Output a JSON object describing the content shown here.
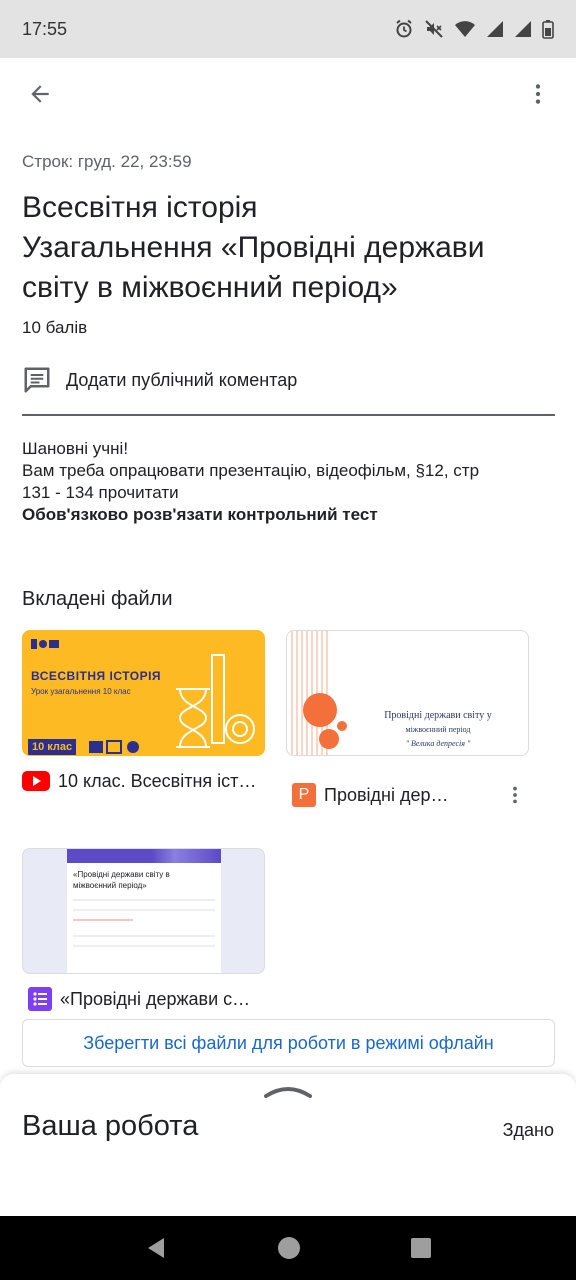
{
  "status_bar": {
    "time": "17:55"
  },
  "assignment": {
    "due": "Строк: груд. 22, 23:59",
    "title_line1": "Всесвітня історія",
    "title_line2": "Узагальнення «Провідні держави",
    "title_line3": "світу в міжвоєнний період»",
    "points": "10 балів",
    "comment_label": "Додати публічний коментар"
  },
  "description": {
    "line1": "Шановні учні!",
    "line2": "Вам треба опрацювати презентацію, відеофільм, §12, стр",
    "line3": "131 - 134 прочитати",
    "line4": "Обов'язково розв'язати контрольний тест"
  },
  "attachments": {
    "heading": "Вкладені файли",
    "files": [
      {
        "name": "10 клас. Всесвітня іст…",
        "type": "youtube",
        "thumb_title": "ВСЕСВІТНЯ ІСТОРІЯ",
        "thumb_sub": "Урок узагальнення 10 клас",
        "thumb_badge": "10 клас"
      },
      {
        "name": "Провідні дер…",
        "type": "slides",
        "type_letter": "P",
        "thumb_title": "Провідні держави світу у",
        "thumb_sub": "міжвоєнний період",
        "thumb_quote": "\" Велика депресія \""
      },
      {
        "name": "«Провідні держави с…",
        "type": "forms",
        "thumb_title": "«Провідні держави світу в",
        "thumb_title2": "міжвоєнний період»"
      }
    ],
    "offline_button": "Зберегти всі файли для роботи в режимі офлайн"
  },
  "your_work": {
    "title": "Ваша робота",
    "status": "Здано"
  },
  "colors": {
    "accent_blue": "#1967d2",
    "youtube_red": "#ff0000",
    "slides_orange": "#f4703b",
    "forms_purple": "#7e3ff2",
    "thumb_yellow": "#fdba22"
  }
}
